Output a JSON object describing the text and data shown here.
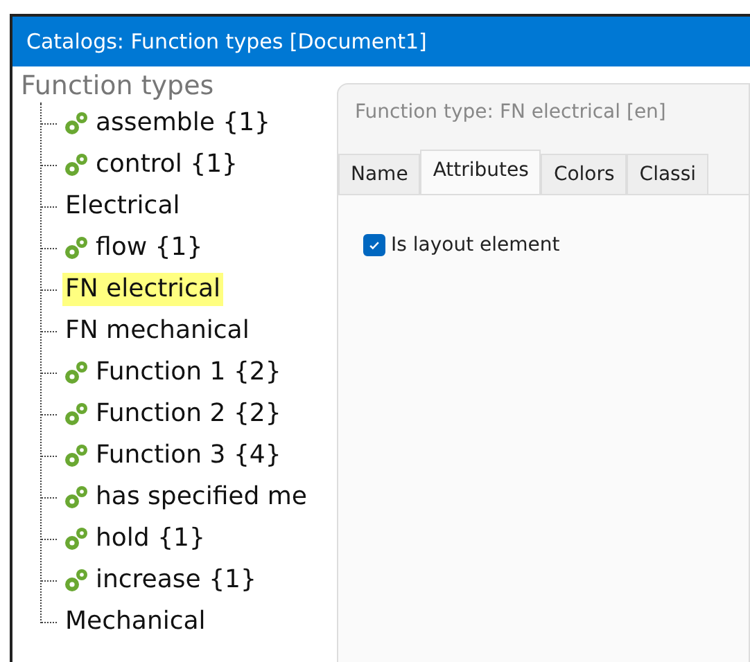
{
  "window": {
    "title": "Catalogs: Function types [Document1]"
  },
  "tree": {
    "root": "Function types",
    "children": [
      {
        "label": "assemble {1}",
        "kind": "function",
        "selected": false
      },
      {
        "label": "control {1}",
        "kind": "function",
        "selected": false
      },
      {
        "label": "Electrical",
        "kind": "folder",
        "selected": false
      },
      {
        "label": "flow {1}",
        "kind": "function",
        "selected": false
      },
      {
        "label": "FN electrical",
        "kind": "folder",
        "selected": true
      },
      {
        "label": "FN mechanical",
        "kind": "folder",
        "selected": false
      },
      {
        "label": "Function 1 {2}",
        "kind": "function",
        "selected": false
      },
      {
        "label": "Function 2 {2}",
        "kind": "function",
        "selected": false
      },
      {
        "label": "Function 3 {4}",
        "kind": "function",
        "selected": false
      },
      {
        "label": "has specified me",
        "kind": "function",
        "selected": false
      },
      {
        "label": "hold {1}",
        "kind": "function",
        "selected": false
      },
      {
        "label": "increase {1}",
        "kind": "function",
        "selected": false
      },
      {
        "label": "Mechanical",
        "kind": "folder",
        "selected": false
      }
    ]
  },
  "detail": {
    "title": "Function type: FN electrical  [en]",
    "tabs": [
      {
        "label": "Name",
        "selected": false
      },
      {
        "label": "Attributes",
        "selected": true
      },
      {
        "label": "Colors",
        "selected": false
      },
      {
        "label": "Classi",
        "selected": false
      }
    ],
    "checkbox": {
      "label": "Is layout element",
      "checked": true
    }
  }
}
